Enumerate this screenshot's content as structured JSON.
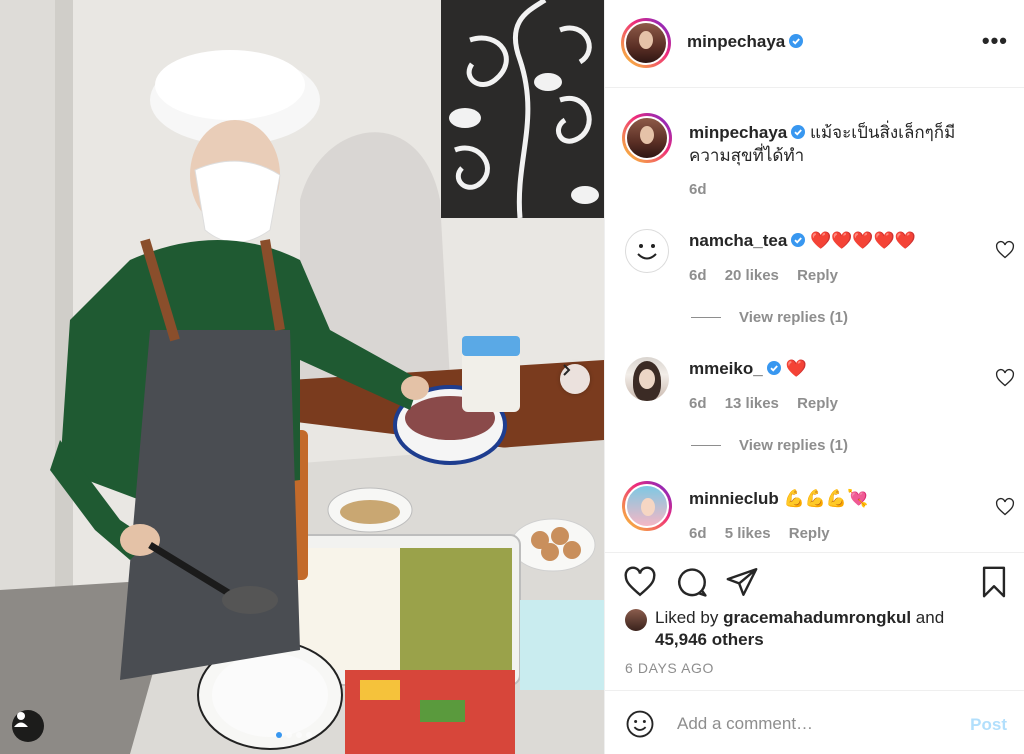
{
  "post": {
    "author": "minpechaya",
    "verified": true,
    "caption": "แม้จะเป็นสิ่งเล็กๆก็มีความสุขที่ได้ทำ",
    "caption_age": "6d",
    "more_icon": "more-horizontal-icon"
  },
  "comments": [
    {
      "user": "namcha_tea",
      "verified": true,
      "text": "❤️❤️❤️❤️❤️",
      "age": "6d",
      "likes": "20 likes",
      "reply": "Reply",
      "view_replies": "View replies (1)"
    },
    {
      "user": "mmeiko_",
      "verified": true,
      "text": "❤️",
      "age": "6d",
      "likes": "13 likes",
      "reply": "Reply",
      "view_replies": "View replies (1)"
    },
    {
      "user": "minnieclub",
      "verified": false,
      "text": "💪💪💪💘",
      "age": "6d",
      "likes": "5 likes",
      "reply": "Reply"
    }
  ],
  "actions": {
    "icons": [
      "heart-icon",
      "comment-icon",
      "share-icon",
      "bookmark-icon"
    ],
    "liked_by_prefix": "Liked by",
    "liked_by_user": "gracemahadumrongkul",
    "liked_by_and": "and",
    "liked_by_others": "45,946 others",
    "timestamp": "6 DAYS AGO"
  },
  "add_comment": {
    "placeholder": "Add a comment…",
    "post_label": "Post"
  },
  "colors": {
    "verified_blue": "#3897f0",
    "post_disabled": "#b2dffc",
    "secondary_text": "#8e8e8e",
    "border": "#efefef"
  }
}
